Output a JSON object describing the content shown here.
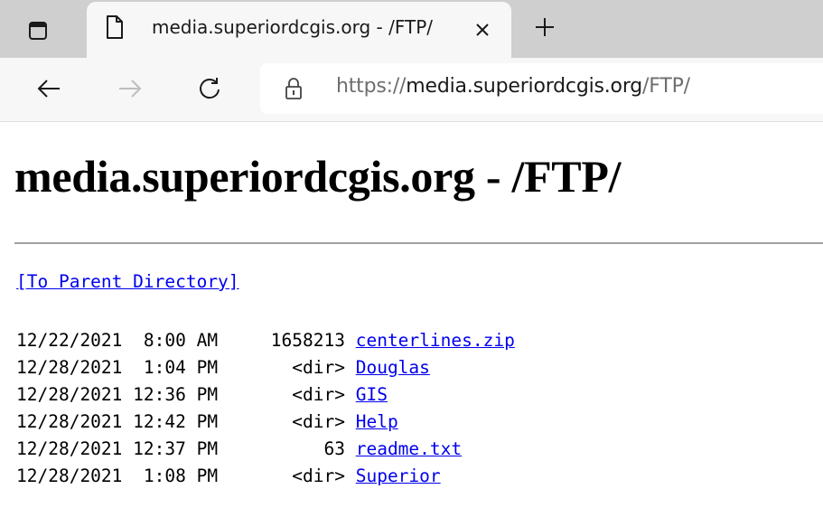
{
  "browser": {
    "tab": {
      "title": "media.superiordcgis.org - /FTP/"
    },
    "address": {
      "scheme": "https://",
      "host": "media.superiordcgis.org",
      "path": "/FTP/"
    },
    "icons": [
      "window-icon",
      "page-icon",
      "close-icon",
      "new-tab-icon",
      "back-icon",
      "forward-icon",
      "reload-icon",
      "lock-icon"
    ]
  },
  "page": {
    "heading": "media.superiordcgis.org - /FTP/",
    "parent_link": "[To Parent Directory]",
    "entries": [
      {
        "date": "12/22/2021",
        "time": " 8:00 AM",
        "size": "1658213",
        "name": "centerlines.zip"
      },
      {
        "date": "12/28/2021",
        "time": " 1:04 PM",
        "size": "  <dir>",
        "name": "Douglas"
      },
      {
        "date": "12/28/2021",
        "time": "12:36 PM",
        "size": "  <dir>",
        "name": "GIS"
      },
      {
        "date": "12/28/2021",
        "time": "12:42 PM",
        "size": "  <dir>",
        "name": "Help"
      },
      {
        "date": "12/28/2021",
        "time": "12:37 PM",
        "size": "     63",
        "name": "readme.txt"
      },
      {
        "date": "12/28/2021",
        "time": " 1:08 PM",
        "size": "  <dir>",
        "name": "Superior"
      }
    ]
  }
}
